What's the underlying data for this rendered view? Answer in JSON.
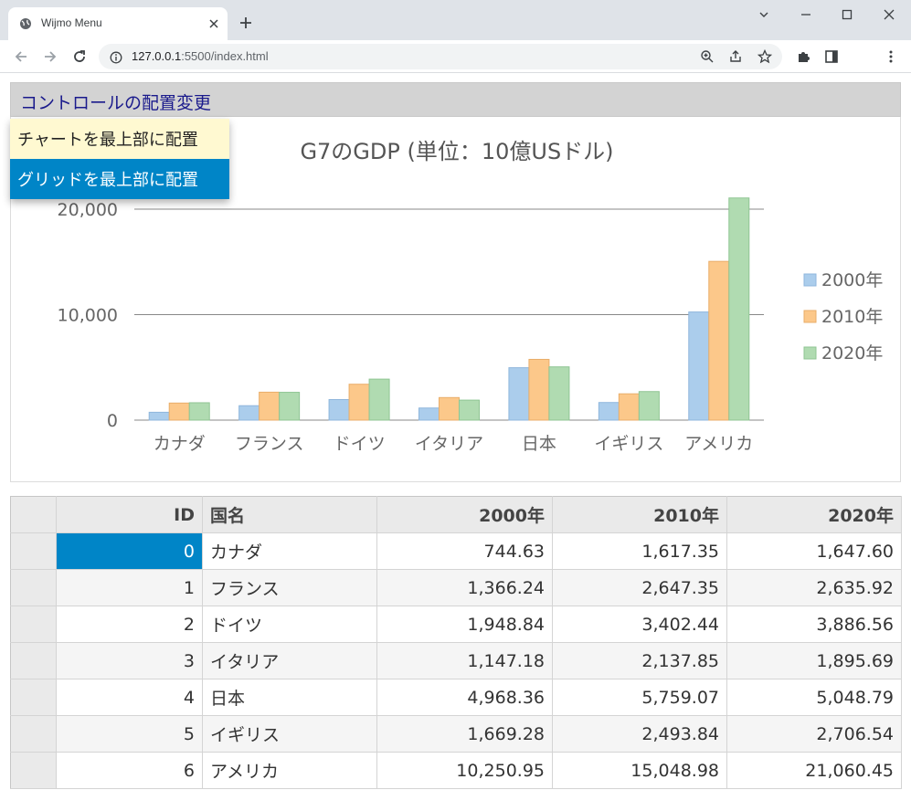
{
  "browser": {
    "tab_title": "Wijmo Menu",
    "url_host": "127.0.0.1",
    "url_rest": ":5500/index.html"
  },
  "menu": {
    "header": "コントロールの配置変更",
    "items": [
      "チャートを最上部に配置",
      "グリッドを最上部に配置"
    ],
    "hover_index": 0,
    "active_index": 1
  },
  "colors": {
    "series": [
      "#abcdec",
      "#fcc88a",
      "#b0dbb1"
    ],
    "menu_active": "#0085c7",
    "menu_hover": "#fff9d1"
  },
  "chart_data": {
    "type": "bar",
    "title": "G7のGDP (単位：10億USドル)",
    "categories": [
      "カナダ",
      "フランス",
      "ドイツ",
      "イタリア",
      "日本",
      "イギリス",
      "アメリカ"
    ],
    "series": [
      {
        "name": "2000年",
        "values": [
          744.63,
          1366.24,
          1948.84,
          1147.18,
          4968.36,
          1669.28,
          10250.95
        ]
      },
      {
        "name": "2010年",
        "values": [
          1617.35,
          2647.35,
          3402.44,
          2137.85,
          5759.07,
          2493.84,
          15048.98
        ]
      },
      {
        "name": "2020年",
        "values": [
          1647.6,
          2635.92,
          3886.56,
          1895.69,
          5048.79,
          2706.54,
          21060.45
        ]
      }
    ],
    "yticks": [
      0,
      10000,
      20000
    ],
    "ytick_labels": [
      "0",
      "10,000",
      "20,000"
    ],
    "ylim": [
      0,
      22000
    ],
    "grid": true,
    "legend": "right"
  },
  "grid": {
    "columns": [
      "ID",
      "国名",
      "2000年",
      "2010年",
      "2020年"
    ],
    "rows": [
      [
        "0",
        "カナダ",
        "744.63",
        "1,617.35",
        "1,647.60"
      ],
      [
        "1",
        "フランス",
        "1,366.24",
        "2,647.35",
        "2,635.92"
      ],
      [
        "2",
        "ドイツ",
        "1,948.84",
        "3,402.44",
        "3,886.56"
      ],
      [
        "3",
        "イタリア",
        "1,147.18",
        "2,137.85",
        "1,895.69"
      ],
      [
        "4",
        "日本",
        "4,968.36",
        "5,759.07",
        "5,048.79"
      ],
      [
        "5",
        "イギリス",
        "1,669.28",
        "2,493.84",
        "2,706.54"
      ],
      [
        "6",
        "アメリカ",
        "10,250.95",
        "15,048.98",
        "21,060.45"
      ]
    ]
  }
}
